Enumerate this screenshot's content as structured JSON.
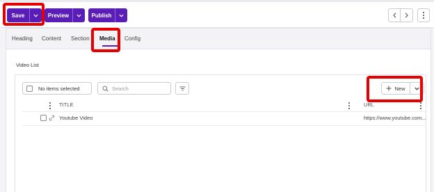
{
  "toolbar": {
    "save_label": "Save",
    "preview_label": "Preview",
    "publish_label": "Publish",
    "accent_color": "#5a1db8",
    "highlight_color": "#e60000"
  },
  "tabs": [
    {
      "label": "Heading",
      "active": false
    },
    {
      "label": "Content",
      "active": false
    },
    {
      "label": "Section",
      "active": false
    },
    {
      "label": "Media",
      "active": true
    },
    {
      "label": "Config",
      "active": false
    }
  ],
  "media": {
    "section_title": "Video List",
    "selection_label": "No items selected",
    "search_placeholder": "Search",
    "new_label": "New",
    "columns": {
      "title": "TITLE",
      "url": "URL"
    },
    "rows": [
      {
        "title": "Youtube Video",
        "url": "https://www.youtube.com..."
      }
    ]
  },
  "icons": {
    "dropdown": "chevron-down-icon",
    "prev": "chevron-left-icon",
    "next": "chevron-right-icon",
    "more": "more-vertical-icon",
    "search": "search-icon",
    "filter": "filter-icon",
    "add": "plus-icon",
    "link": "link-icon"
  }
}
